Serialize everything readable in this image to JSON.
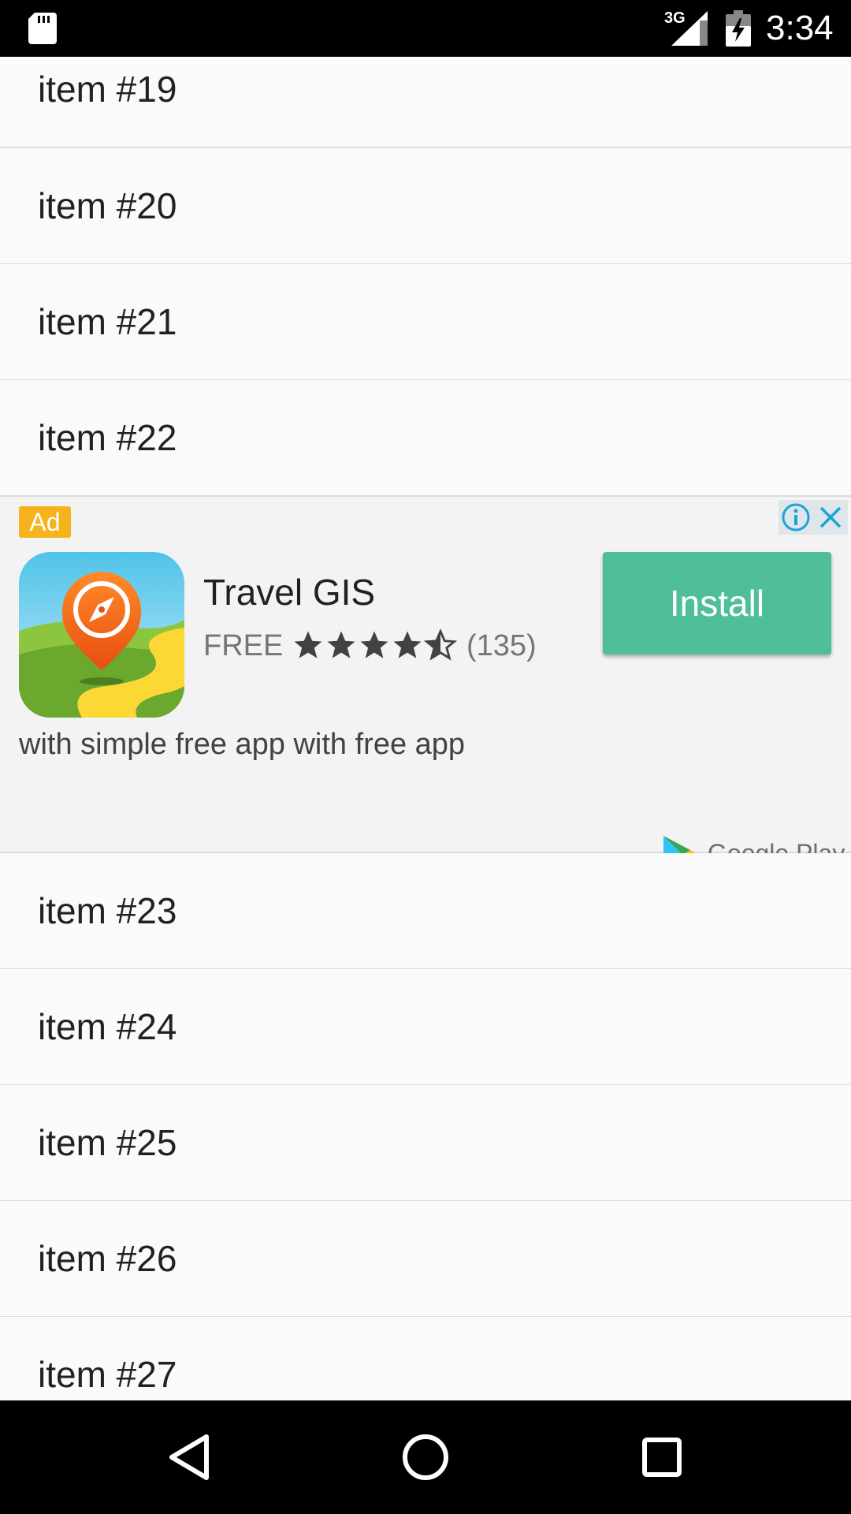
{
  "status_bar": {
    "network_type": "3G",
    "time": "3:34",
    "icons": [
      "sd-card-icon",
      "signal-icon",
      "battery-charging-icon"
    ]
  },
  "list": {
    "items": [
      {
        "label": "item #19"
      },
      {
        "label": "item #20"
      },
      {
        "label": "item #21"
      },
      {
        "label": "item #22"
      },
      {
        "label": "item #23"
      },
      {
        "label": "item #24"
      },
      {
        "label": "item #25"
      },
      {
        "label": "item #26"
      },
      {
        "label": "item #27"
      }
    ]
  },
  "ad": {
    "badge": "Ad",
    "app_name": "Travel GIS",
    "price": "FREE",
    "rating": 4.5,
    "rating_count": "(135)",
    "install_label": "Install",
    "description": "with simple free app with free app",
    "store_label": "Google Play",
    "icons": [
      "info-icon",
      "close-icon",
      "app-icon",
      "google-play-icon"
    ]
  },
  "nav_bar": {
    "icons": [
      "back-icon",
      "home-icon",
      "recents-icon"
    ]
  },
  "colors": {
    "install_button": "#4fbf98",
    "ad_badge": "#f7b31c",
    "ad_background": "#f3f3f3",
    "list_background": "#fafafa",
    "ad_info_accent": "#1aa3d9"
  }
}
